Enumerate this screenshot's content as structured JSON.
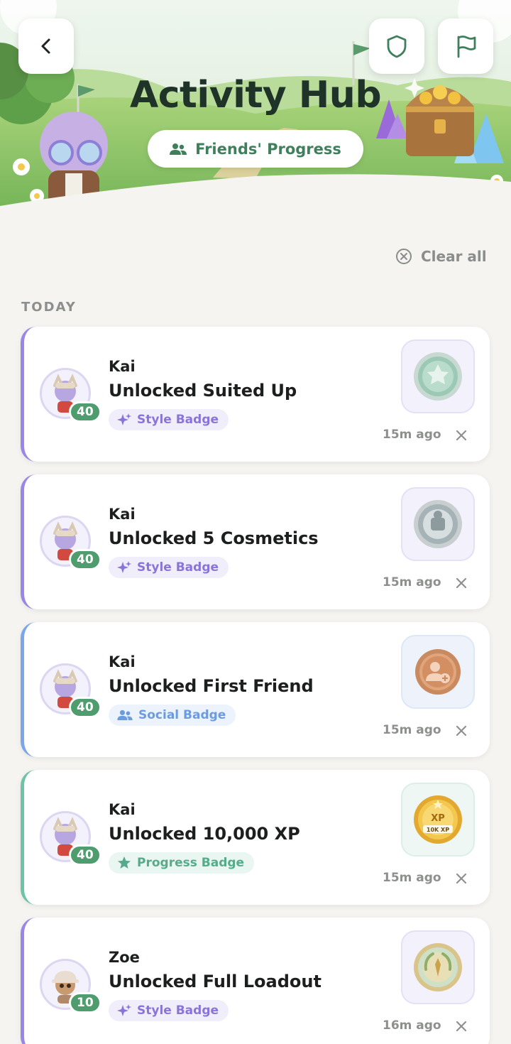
{
  "header": {
    "title": "Activity Hub",
    "filter_chip": "Friends' Progress",
    "back_icon": "chevron-left-icon",
    "shield_icon": "shield-icon",
    "flag_icon": "flag-icon"
  },
  "list": {
    "clear_all_label": "Clear all",
    "section_label": "TODAY"
  },
  "activities": [
    {
      "name": "Kai",
      "title": "Unlocked Suited Up",
      "badge_type": "Style Badge",
      "level": "40",
      "time": "15m ago",
      "medal": "silver-green-medal",
      "accent": "#9a86e6"
    },
    {
      "name": "Kai",
      "title": "Unlocked 5 Cosmetics",
      "badge_type": "Style Badge",
      "level": "40",
      "time": "15m ago",
      "medal": "silver-medal",
      "accent": "#9a86e6"
    },
    {
      "name": "Kai",
      "title": "Unlocked First Friend",
      "badge_type": "Social Badge",
      "level": "40",
      "time": "15m ago",
      "medal": "bronze-friend-medal",
      "accent": "#7aa6ec"
    },
    {
      "name": "Kai",
      "title": "Unlocked 10,000 XP",
      "badge_type": "Progress Badge",
      "level": "40",
      "time": "15m ago",
      "medal": "gold-xp-medal",
      "medal_text": "10K XP",
      "accent": "#6cc3a5"
    },
    {
      "name": "Zoe",
      "title": "Unlocked Full Loadout",
      "badge_type": "Style Badge",
      "level": "10",
      "time": "16m ago",
      "medal": "gold-laurel-medal",
      "accent": "#9a86e6"
    }
  ]
}
